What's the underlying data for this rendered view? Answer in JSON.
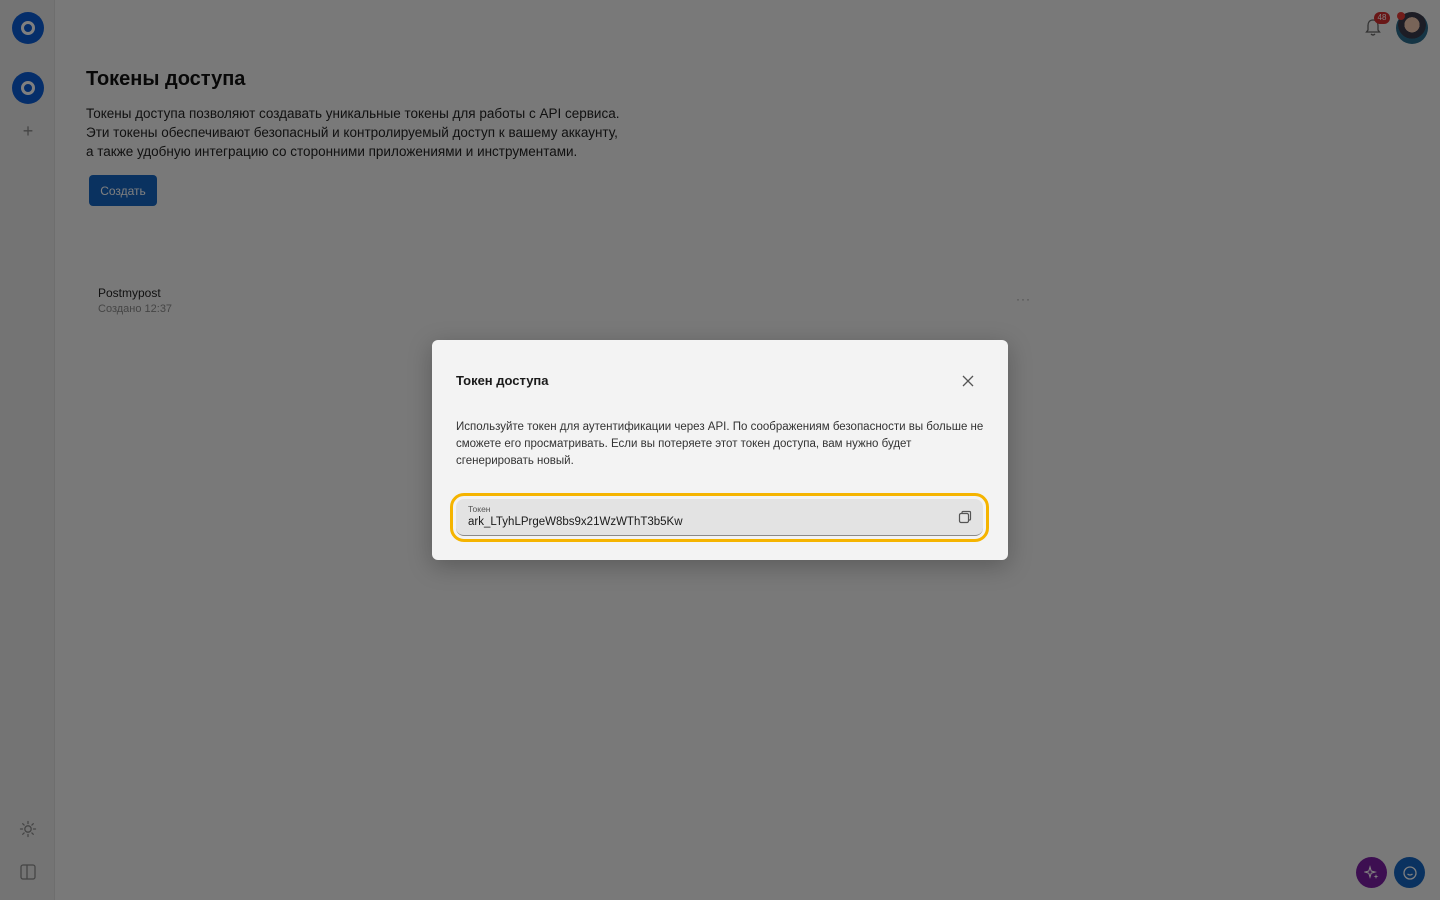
{
  "page": {
    "title": "Токены доступа",
    "description_lines": [
      "Токены доступа позволяют создавать уникальные токены для работы с API сервиса.",
      "Эти токены обеспечивают безопасный и контролируемый доступ к вашему аккаунту,",
      "а также удобную интеграцию со сторонними приложениями и инструментами."
    ],
    "create_label": "Создать"
  },
  "tokens": [
    {
      "name": "Postmypost",
      "created": "Создано 12:37",
      "more": "···"
    }
  ],
  "header": {
    "notifications_count": "48"
  },
  "sidebar": {
    "add_label": "+"
  },
  "modal": {
    "title": "Токен доступа",
    "text": "Используйте токен для аутентификации через API. По соображениям безопасности вы больше не сможете его просматривать. Если вы потеряете этот токен доступа, вам нужно будет сгенерировать новый.",
    "field_label": "Токен",
    "token_value": "ark_LTyhLPrgeW8bs9x21WzWThT3b5Kw"
  },
  "colors": {
    "accent": "#1565c0",
    "highlight": "#f5b400",
    "ai_button": "#7b1fa2",
    "badge": "#d32f2f"
  },
  "icons": [
    "app-logo-icon",
    "workspace-icon",
    "plus-icon",
    "theme-icon",
    "panel-toggle-icon",
    "bell-icon",
    "close-icon",
    "copy-icon",
    "sparkle-icon",
    "chat-icon"
  ]
}
